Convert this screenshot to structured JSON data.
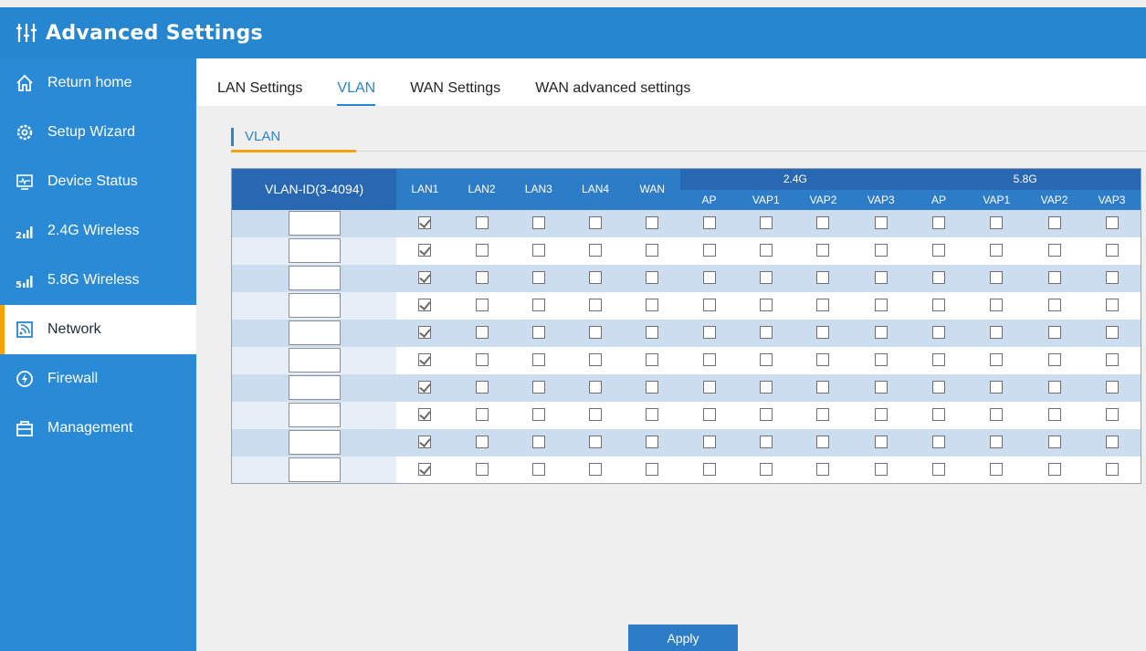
{
  "header": {
    "title": "Advanced Settings",
    "icon": "sliders-icon"
  },
  "sidebar": {
    "items": [
      {
        "label": "Return home",
        "icon": "home-icon",
        "active": false
      },
      {
        "label": "Setup Wizard",
        "icon": "gear-icon",
        "active": false
      },
      {
        "label": "Device Status",
        "icon": "monitor-icon",
        "active": false
      },
      {
        "label": "2.4G Wireless",
        "icon": "signal-2g-icon",
        "active": false
      },
      {
        "label": "5.8G Wireless",
        "icon": "signal-5g-icon",
        "active": false
      },
      {
        "label": "Network",
        "icon": "network-icon",
        "active": true
      },
      {
        "label": "Firewall",
        "icon": "firewall-icon",
        "active": false
      },
      {
        "label": "Management",
        "icon": "management-icon",
        "active": false
      }
    ]
  },
  "tabs": [
    {
      "label": "LAN Settings",
      "active": false
    },
    {
      "label": "VLAN",
      "active": true
    },
    {
      "label": "WAN Settings",
      "active": false
    },
    {
      "label": "WAN advanced settings",
      "active": false
    }
  ],
  "section": {
    "label": "VLAN"
  },
  "table": {
    "vlan_id_header": "VLAN-ID(3-4094)",
    "port_headers": [
      "LAN1",
      "LAN2",
      "LAN3",
      "LAN4",
      "WAN"
    ],
    "group_24": {
      "label": "2.4G",
      "cols": [
        "AP",
        "VAP1",
        "VAP2",
        "VAP3"
      ]
    },
    "group_58": {
      "label": "5.8G",
      "cols": [
        "AP",
        "VAP1",
        "VAP2",
        "VAP3"
      ]
    },
    "rows": [
      {
        "vlan_id": "",
        "checks": [
          true,
          false,
          false,
          false,
          false,
          false,
          false,
          false,
          false,
          false,
          false,
          false,
          false
        ]
      },
      {
        "vlan_id": "",
        "checks": [
          true,
          false,
          false,
          false,
          false,
          false,
          false,
          false,
          false,
          false,
          false,
          false,
          false
        ]
      },
      {
        "vlan_id": "",
        "checks": [
          true,
          false,
          false,
          false,
          false,
          false,
          false,
          false,
          false,
          false,
          false,
          false,
          false
        ]
      },
      {
        "vlan_id": "",
        "checks": [
          true,
          false,
          false,
          false,
          false,
          false,
          false,
          false,
          false,
          false,
          false,
          false,
          false
        ]
      },
      {
        "vlan_id": "",
        "checks": [
          true,
          false,
          false,
          false,
          false,
          false,
          false,
          false,
          false,
          false,
          false,
          false,
          false
        ]
      },
      {
        "vlan_id": "",
        "checks": [
          true,
          false,
          false,
          false,
          false,
          false,
          false,
          false,
          false,
          false,
          false,
          false,
          false
        ]
      },
      {
        "vlan_id": "",
        "checks": [
          true,
          false,
          false,
          false,
          false,
          false,
          false,
          false,
          false,
          false,
          false,
          false,
          false
        ]
      },
      {
        "vlan_id": "",
        "checks": [
          true,
          false,
          false,
          false,
          false,
          false,
          false,
          false,
          false,
          false,
          false,
          false,
          false
        ]
      },
      {
        "vlan_id": "",
        "checks": [
          true,
          false,
          false,
          false,
          false,
          false,
          false,
          false,
          false,
          false,
          false,
          false,
          false
        ]
      },
      {
        "vlan_id": "",
        "checks": [
          true,
          false,
          false,
          false,
          false,
          false,
          false,
          false,
          false,
          false,
          false,
          false,
          false
        ]
      }
    ]
  },
  "apply_label": "Apply",
  "colors": {
    "primary": "#2686cf",
    "sidebar": "#2b8ad6",
    "accent": "#f5a20b"
  }
}
